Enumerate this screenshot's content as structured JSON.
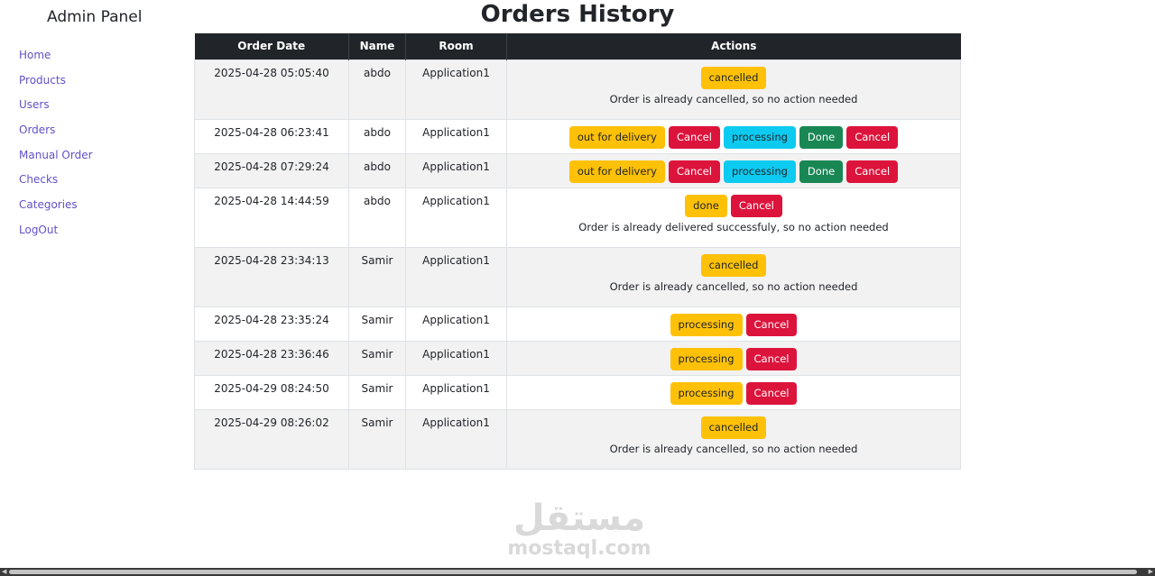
{
  "sidebar": {
    "brand": "Admin Panel",
    "items": [
      {
        "label": "Home"
      },
      {
        "label": "Products"
      },
      {
        "label": "Users"
      },
      {
        "label": "Orders"
      },
      {
        "label": "Manual Order"
      },
      {
        "label": "Checks"
      },
      {
        "label": "Categories"
      },
      {
        "label": "LogOut"
      }
    ]
  },
  "page": {
    "title": "Orders History"
  },
  "table": {
    "headers": [
      "Order Date",
      "Name",
      "Room",
      "Actions"
    ],
    "rows": [
      {
        "date": "2025-04-28 05:05:40",
        "name": "abdo",
        "room": "Application1",
        "buttons": [
          "cancelled"
        ],
        "message": "Order is already cancelled, so no action needed"
      },
      {
        "date": "2025-04-28 06:23:41",
        "name": "abdo",
        "room": "Application1",
        "buttons": [
          "out for delivery",
          "Cancel",
          "processing",
          "Done",
          "Cancel"
        ]
      },
      {
        "date": "2025-04-28 07:29:24",
        "name": "abdo",
        "room": "Application1",
        "buttons": [
          "out for delivery",
          "Cancel",
          "processing",
          "Done",
          "Cancel"
        ]
      },
      {
        "date": "2025-04-28 14:44:59",
        "name": "abdo",
        "room": "Application1",
        "buttons": [
          "done",
          "Cancel"
        ],
        "message": "Order is already delivered successfuly, so no action needed"
      },
      {
        "date": "2025-04-28 23:34:13",
        "name": "Samir",
        "room": "Application1",
        "buttons": [
          "cancelled"
        ],
        "message": "Order is already cancelled, so no action needed"
      },
      {
        "date": "2025-04-28 23:35:24",
        "name": "Samir",
        "room": "Application1",
        "buttons": [
          "processing",
          "Cancel"
        ]
      },
      {
        "date": "2025-04-28 23:36:46",
        "name": "Samir",
        "room": "Application1",
        "buttons": [
          "processing",
          "Cancel"
        ]
      },
      {
        "date": "2025-04-29 08:24:50",
        "name": "Samir",
        "room": "Application1",
        "buttons": [
          "processing",
          "Cancel"
        ]
      },
      {
        "date": "2025-04-29 08:26:02",
        "name": "Samir",
        "room": "Application1",
        "buttons": [
          "cancelled"
        ],
        "message": "Order is already cancelled, so no action needed"
      }
    ]
  },
  "watermark": {
    "arabic": "مستقل",
    "latin": "mostaql.com"
  },
  "colors": {
    "header_bg": "#212529",
    "link": "#6251c9",
    "warning": "#ffc107",
    "danger": "#dc143c",
    "info": "#0dcaf0",
    "success": "#198754",
    "stripe": "#f2f2f2"
  }
}
